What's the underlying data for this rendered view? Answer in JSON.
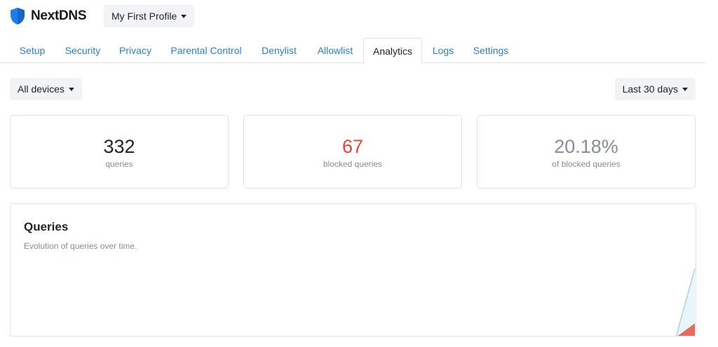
{
  "brand": {
    "name": "NextDNS",
    "color": "#1f7ee8"
  },
  "profile": {
    "label": "My First Profile"
  },
  "tabs": [
    {
      "label": "Setup",
      "active": false
    },
    {
      "label": "Security",
      "active": false
    },
    {
      "label": "Privacy",
      "active": false
    },
    {
      "label": "Parental Control",
      "active": false
    },
    {
      "label": "Denylist",
      "active": false
    },
    {
      "label": "Allowlist",
      "active": false
    },
    {
      "label": "Analytics",
      "active": true
    },
    {
      "label": "Logs",
      "active": false
    },
    {
      "label": "Settings",
      "active": false
    }
  ],
  "filters": {
    "devices": "All devices",
    "range": "Last 30 days"
  },
  "stats": [
    {
      "value": "332",
      "label": "queries",
      "color": "#212529"
    },
    {
      "value": "67",
      "label": "blocked queries",
      "color": "#e0453d"
    },
    {
      "value": "20.18%",
      "label": "of blocked queries",
      "color": "#868e96"
    }
  ],
  "queries_chart": {
    "title": "Queries",
    "subtitle": "Evolution of queries over time.",
    "colors": {
      "total_line": "#a9d2ec",
      "total_fill": "#eaf4fb",
      "blocked_fill": "#e66a5e"
    },
    "chart_data": {
      "type": "area",
      "series": [
        {
          "values": [
            0,
            0,
            0,
            0,
            0,
            0,
            0,
            0,
            0,
            0,
            0,
            0,
            0,
            0,
            0,
            0,
            0,
            0,
            0,
            0,
            0,
            0,
            0,
            0,
            0,
            0,
            0,
            0,
            0,
            332
          ]
        },
        {
          "values": [
            0,
            0,
            0,
            0,
            0,
            0,
            0,
            0,
            0,
            0,
            0,
            0,
            0,
            0,
            0,
            0,
            0,
            0,
            0,
            0,
            0,
            0,
            0,
            0,
            0,
            0,
            0,
            0,
            0,
            67
          ]
        }
      ]
    }
  }
}
